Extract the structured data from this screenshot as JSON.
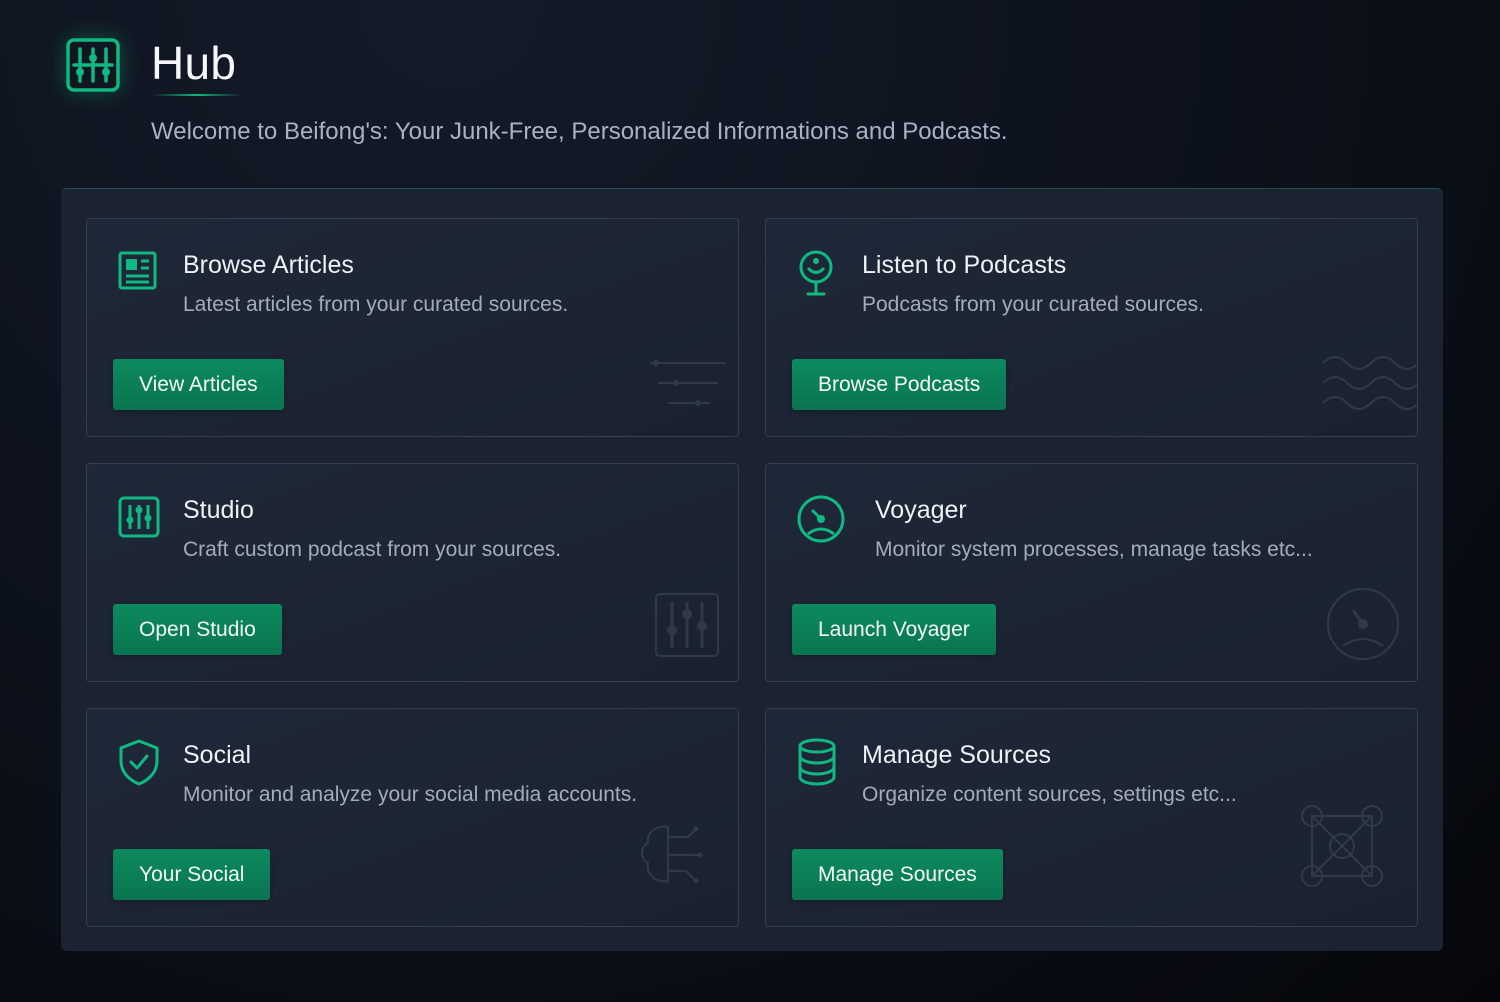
{
  "header": {
    "title": "Hub",
    "subtitle": "Welcome to Beifong's: Your Junk-Free, Personalized Informations and Podcasts.",
    "logo_icon": "equalizer-icon"
  },
  "colors": {
    "accent": "#10b981",
    "button": "#0c8a5e",
    "panel": "#1b2331",
    "card": "#1f2838",
    "background": "#0c111b"
  },
  "cards": [
    {
      "title": "Browse Articles",
      "description": "Latest articles from your curated sources.",
      "button": "View Articles",
      "icon": "newspaper-icon",
      "decoration": "sliders-lines-icon"
    },
    {
      "title": "Listen to Podcasts",
      "description": "Podcasts from your curated sources.",
      "button": "Browse Podcasts",
      "icon": "microphone-icon",
      "decoration": "sound-waves-icon"
    },
    {
      "title": "Studio",
      "description": "Craft custom podcast from your sources.",
      "button": "Open Studio",
      "icon": "mixer-sliders-icon",
      "decoration": "mixer-sliders-icon"
    },
    {
      "title": "Voyager",
      "description": "Monitor system processes, manage tasks etc...",
      "button": "Launch Voyager",
      "icon": "gauge-icon",
      "decoration": "gauge-icon"
    },
    {
      "title": "Social",
      "description": "Monitor and analyze your social media accounts.",
      "button": "Your Social",
      "icon": "shield-check-icon",
      "decoration": "brain-circuit-icon"
    },
    {
      "title": "Manage Sources",
      "description": "Organize content sources, settings etc...",
      "button": "Manage Sources",
      "icon": "database-icon",
      "decoration": "network-nodes-icon"
    }
  ]
}
